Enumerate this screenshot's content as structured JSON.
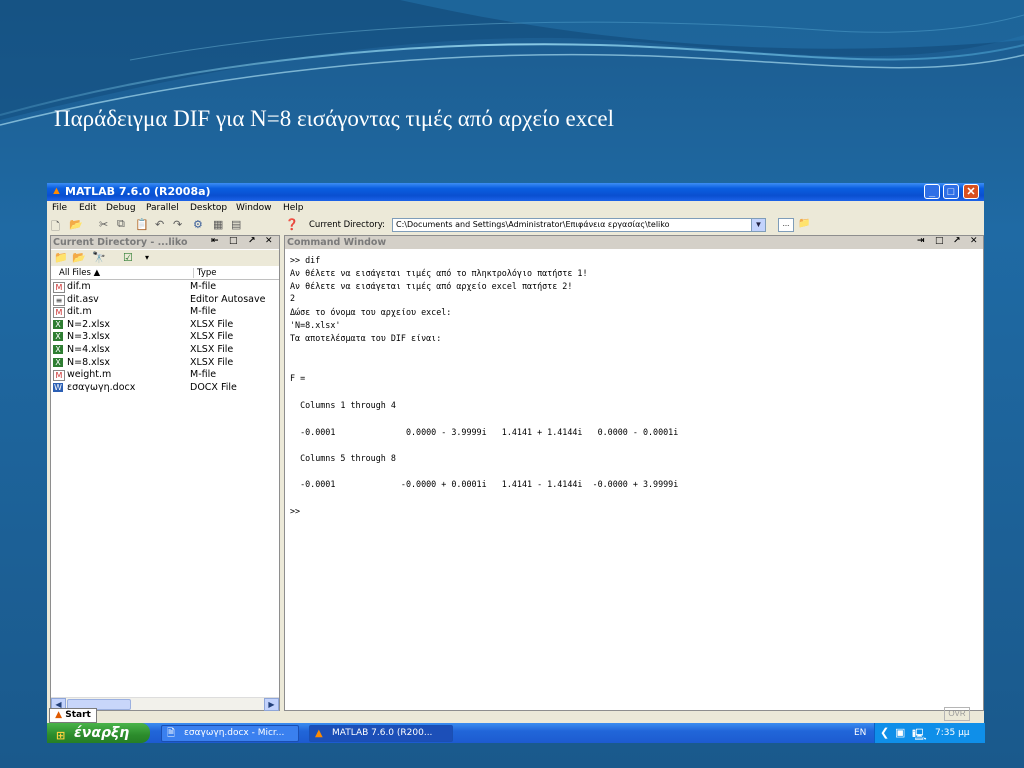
{
  "slide": {
    "title": "Παράδειγμα DIF για Ν=8 εισάγοντας τιμές από αρχείο excel"
  },
  "window": {
    "title": "MATLAB  7.6.0 (R2008a)",
    "minimize": "_",
    "maximize": "□",
    "close": "✕"
  },
  "menu": [
    "File",
    "Edit",
    "Debug",
    "Parallel",
    "Desktop",
    "Window",
    "Help"
  ],
  "toolbar": {
    "current_directory_label": "Current Directory:",
    "current_directory_value": "C:\\Documents and Settings\\Administrator\\Επιφάνεια εργασίας\\teliko",
    "browse_label": "..."
  },
  "current_directory_panel": {
    "title": "Current Directory - ...liko",
    "col_name": "All Files ▲",
    "col_type": "Type",
    "files": [
      {
        "name": "dif.m",
        "type": "M-file",
        "icon": "m-file-icon"
      },
      {
        "name": "dit.asv",
        "type": "Editor Autosave",
        "icon": "asv-file-icon"
      },
      {
        "name": "dit.m",
        "type": "M-file",
        "icon": "m-file-icon"
      },
      {
        "name": "N=2.xlsx",
        "type": "XLSX File",
        "icon": "xlsx-file-icon"
      },
      {
        "name": "N=3.xlsx",
        "type": "XLSX File",
        "icon": "xlsx-file-icon"
      },
      {
        "name": "N=4.xlsx",
        "type": "XLSX File",
        "icon": "xlsx-file-icon"
      },
      {
        "name": "N=8.xlsx",
        "type": "XLSX File",
        "icon": "xlsx-file-icon"
      },
      {
        "name": "weight.m",
        "type": "M-file",
        "icon": "m-file-icon"
      },
      {
        "name": "εσαγωγη.docx",
        "type": "DOCX File",
        "icon": "docx-file-icon"
      }
    ]
  },
  "command_window": {
    "title": "Command Window",
    "lines": [
      ">> dif",
      "Αν θέλετε να εισάγεται τιμές από το πληκτρολόγιο πατήστε 1!",
      "Αν θέλετε να εισάγεται τιμές από αρχείο excel πατήστε 2!",
      "2",
      "Δώσε το όνομα του αρχείου excel:",
      "'N=8.xlsx'",
      "Τα αποτελέσματα του DIF είναι:",
      "F =",
      "  Columns 1 through 4",
      "  -0.0001              0.0000 - 3.9999i   1.4141 + 1.4144i   0.0000 - 0.0001i",
      "  Columns 5 through 8",
      "  -0.0001             -0.0000 + 0.0001i   1.4141 - 1.4144i  -0.0000 + 3.9999i",
      ">>"
    ]
  },
  "status": {
    "start_label": "Start",
    "ovr": "OVR"
  },
  "taskbar": {
    "start_label": "έναρξη",
    "tasks": [
      {
        "label": "εσαγωγη.docx - Micr...",
        "icon": "word-icon"
      },
      {
        "label": "MATLAB  7.6.0 (R200...",
        "icon": "matlab-icon"
      }
    ],
    "language": "EN",
    "clock": "7:35 μμ"
  }
}
